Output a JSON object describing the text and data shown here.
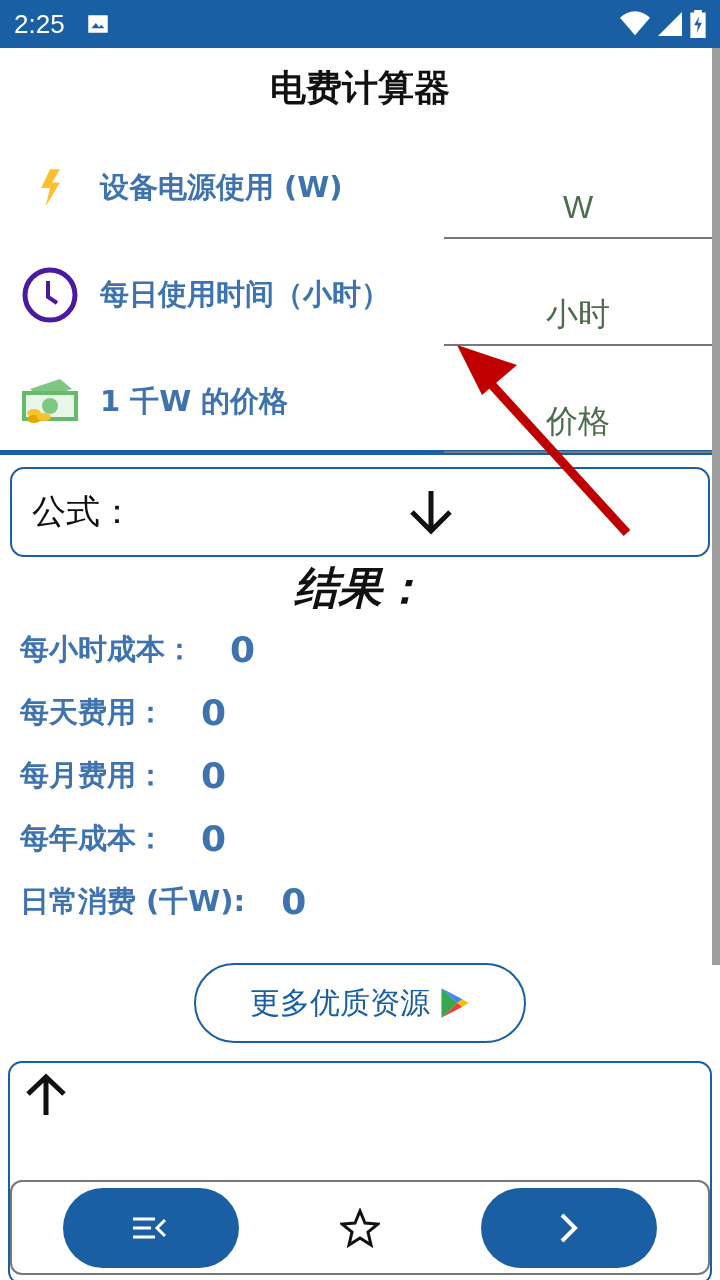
{
  "status_bar": {
    "time": "2:25"
  },
  "title": "电费计算器",
  "inputs": [
    {
      "kind": "bolt",
      "label": "设备电源使用 (W)",
      "placeholder": "W"
    },
    {
      "kind": "clock",
      "label": "每日使用时间（小时）",
      "placeholder": "小时"
    },
    {
      "kind": "money",
      "label": "1 千W 的价格",
      "placeholder": "价格"
    }
  ],
  "formula": {
    "label": "公式："
  },
  "results_title": "结果：",
  "results": [
    {
      "label": "每小时成本：",
      "value": "0"
    },
    {
      "label": "每天费用：",
      "value": "0"
    },
    {
      "label": "每月费用：",
      "value": "0"
    },
    {
      "label": "每年成本：",
      "value": "0"
    },
    {
      "label": "日常消费 (千W):",
      "value": "0"
    }
  ],
  "more_button": "更多优质资源"
}
